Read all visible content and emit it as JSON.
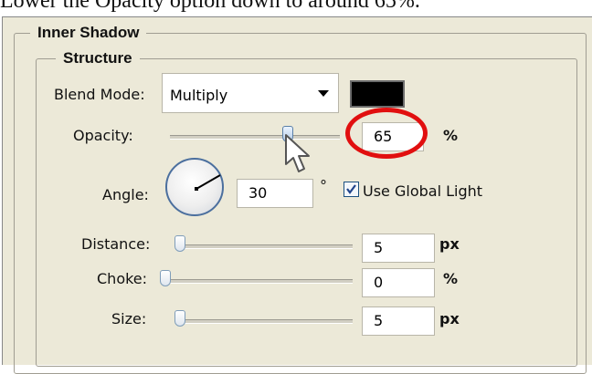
{
  "caption": "Lower the Opacity option down to around 65%.",
  "inner_shadow": {
    "title": "Inner Shadow",
    "structure": {
      "title": "Structure",
      "blend_mode": {
        "label": "Blend Mode:",
        "value": "Multiply",
        "color": "#000000"
      },
      "opacity": {
        "label": "Opacity:",
        "value": "65",
        "unit": "%",
        "slider_percent": 65
      },
      "angle": {
        "label": "Angle:",
        "value": "30",
        "unit": "°",
        "use_global_light_label": "Use Global Light",
        "use_global_light_checked": true
      },
      "distance": {
        "label": "Distance:",
        "value": "5",
        "unit": "px",
        "slider_percent": 0
      },
      "choke": {
        "label": "Choke:",
        "value": "0",
        "unit": "%",
        "slider_percent": 0
      },
      "size": {
        "label": "Size:",
        "value": "5",
        "unit": "px",
        "slider_percent": 0
      }
    }
  },
  "annotation": {
    "highlight_color": "#e10f0f"
  }
}
